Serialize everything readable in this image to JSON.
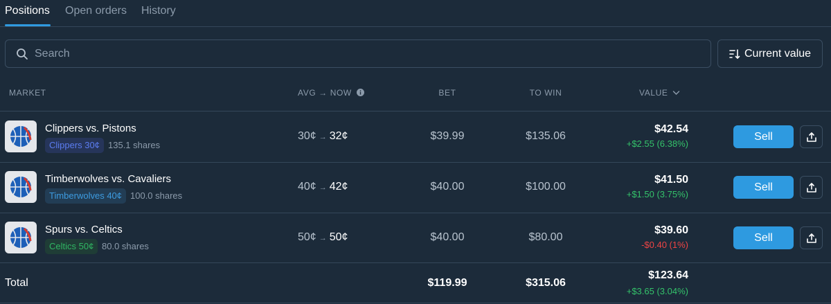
{
  "tabs": [
    {
      "label": "Positions",
      "active": true
    },
    {
      "label": "Open orders",
      "active": false
    },
    {
      "label": "History",
      "active": false
    }
  ],
  "search": {
    "placeholder": "Search",
    "icon": "search-icon"
  },
  "sort": {
    "label": "Current value",
    "icon": "sort-icon"
  },
  "columns": {
    "market": "MARKET",
    "avg_now": "AVG → NOW",
    "bet": "BET",
    "to_win": "TO WIN",
    "value": "VALUE"
  },
  "positions": [
    {
      "title": "Clippers vs. Pistons",
      "chip": "Clippers 30¢",
      "chip_color": "#5b7cf0",
      "chip_bg": "#26355a",
      "shares": "135.1 shares",
      "avg": "30¢",
      "now": "32¢",
      "bet": "$39.99",
      "to_win": "$135.06",
      "value": "$42.54",
      "change": "+$2.55 (6.38%)",
      "change_sign": "pos",
      "sell_label": "Sell"
    },
    {
      "title": "Timberwolves vs. Cavaliers",
      "chip": "Timberwolves 40¢",
      "chip_color": "#3d9be0",
      "chip_bg": "#223d55",
      "shares": "100.0 shares",
      "avg": "40¢",
      "now": "42¢",
      "bet": "$40.00",
      "to_win": "$100.00",
      "value": "$41.50",
      "change": "+$1.50 (3.75%)",
      "change_sign": "pos",
      "sell_label": "Sell"
    },
    {
      "title": "Spurs vs. Celtics",
      "chip": "Celtics 50¢",
      "chip_color": "#2fb563",
      "chip_bg": "#1f3d36",
      "shares": "80.0 shares",
      "avg": "50¢",
      "now": "50¢",
      "bet": "$40.00",
      "to_win": "$80.00",
      "value": "$39.60",
      "change": "-$0.40 (1%)",
      "change_sign": "neg",
      "sell_label": "Sell"
    }
  ],
  "total": {
    "label": "Total",
    "bet": "$119.99",
    "to_win": "$315.06",
    "value": "$123.64",
    "change": "+$3.65 (3.04%)"
  },
  "colors": {
    "background": "#1c2b3a",
    "accent": "#2e9ae0",
    "positive": "#34c26a",
    "negative": "#ef4444"
  }
}
